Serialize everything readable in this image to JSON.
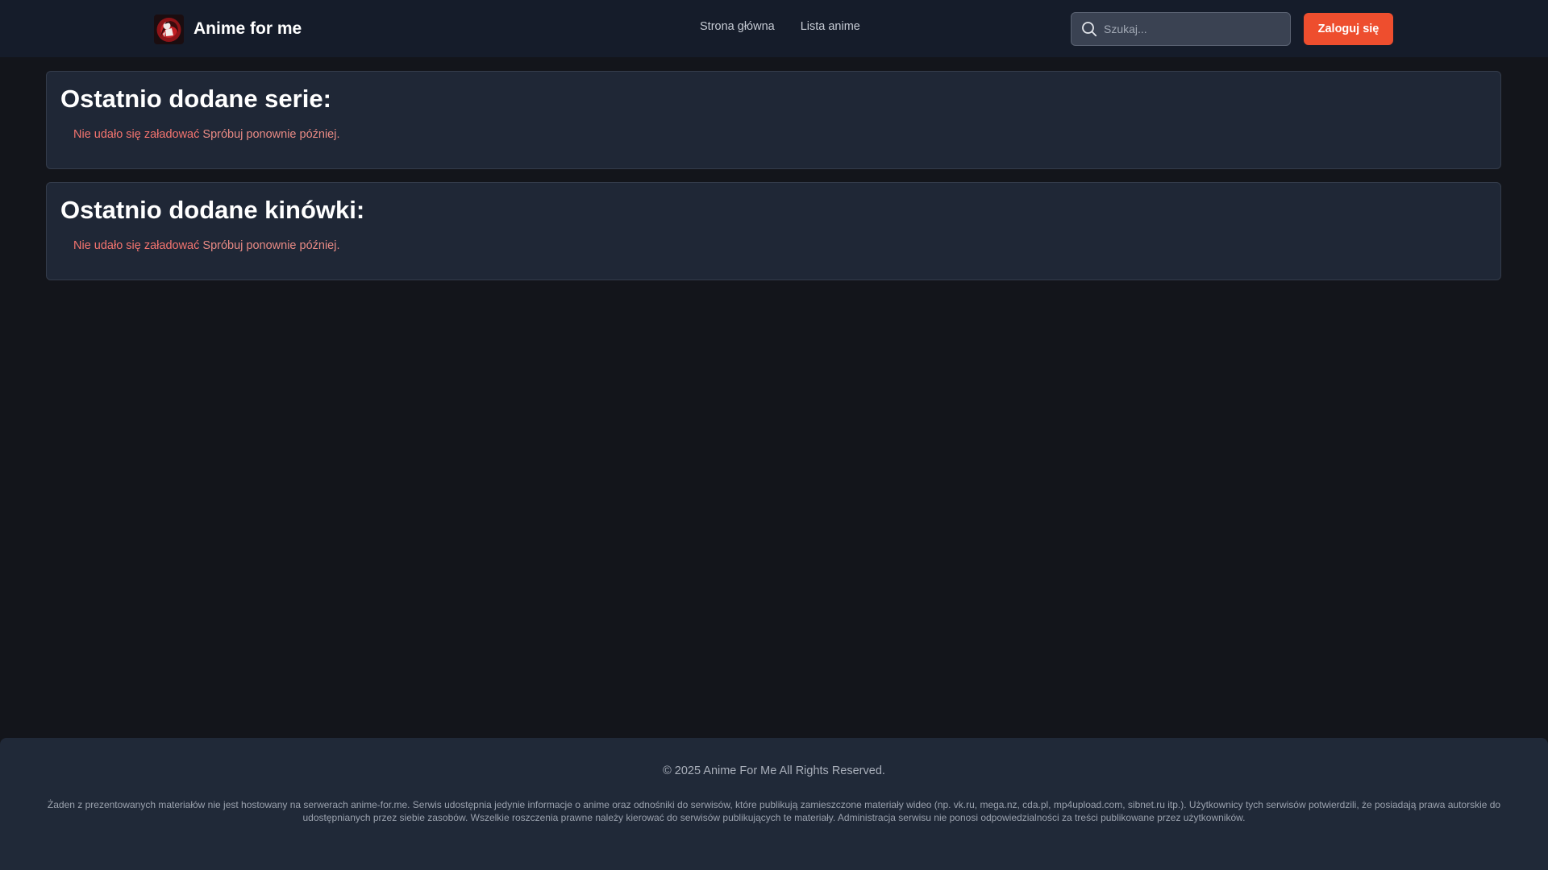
{
  "header": {
    "brand_name": "Anime for me",
    "nav_items": [
      {
        "label": "Strona główna"
      },
      {
        "label": "Lista anime"
      }
    ],
    "search": {
      "placeholder": "Szukaj...",
      "value": ""
    },
    "login_label": "Zaloguj się"
  },
  "main": {
    "sections": [
      {
        "title": "Ostatnio dodane serie:",
        "error_strong": "Nie udało się załadować",
        "error_rest": " Spróbuj ponownie później."
      },
      {
        "title": "Ostatnio dodane kinówki:",
        "error_strong": "Nie udało się załadować",
        "error_rest": " Spróbuj ponownie później."
      }
    ]
  },
  "footer": {
    "copyright": "© 2025 Anime For Me All Rights Reserved.",
    "disclaimer": "Żaden z prezentowanych materiałów nie jest hostowany na serwerach anime-for.me. Serwis udostępnia jedynie informacje o anime oraz odnośniki do serwisów, które publikują zamieszczone materiały wideo (np. vk.ru, mega.nz, cda.pl, mp4upload.com, sibnet.ru itp.). Użytkownicy tych serwisów potwierdzili, że posiadają prawa autorskie do udostępnianych przez siebie zasobów. Wszelkie roszczenia prawne należy kierować do serwisów publikujących te materiały. Administracja serwisu nie ponosi odpowiedzialności za treści publikowane przez użytkowników."
  },
  "colors": {
    "background": "#13151b",
    "navbar": "#151c2a",
    "card": "#1f2736",
    "accent": "#ee4e2e",
    "error": "#f4746f"
  },
  "icons": {
    "logo": "anime-character-logo",
    "search": "search-icon"
  }
}
